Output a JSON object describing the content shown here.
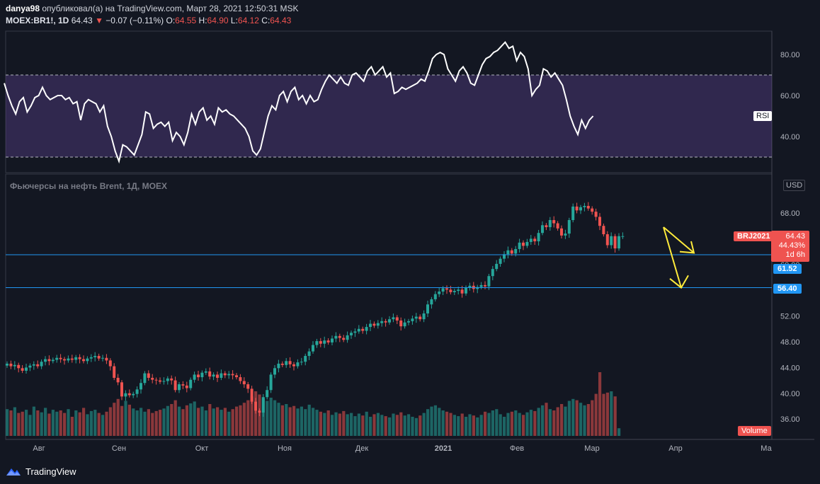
{
  "header": {
    "author": "danya98",
    "published_text": "опубликовал(а) на TradingView.com, Март 28, 2021 12:50:31 MSK",
    "symbol": "MOEX:BR1!, 1D",
    "last": "64.43",
    "change_arrow": "▼",
    "change": "−0.07 (−0.11%)",
    "o_label": "O:",
    "o_value": "64.55",
    "h_label": "H:",
    "h_value": "64.90",
    "l_label": "L:",
    "l_value": "64.12",
    "c_label": "C:",
    "c_value": "64.43"
  },
  "main_title": "Фьючерсы на нефть Brent, 1Д, MOEX",
  "currency_label": "USD",
  "rsi_label": "RSI",
  "volume_label": "Volume",
  "price_tag": {
    "symbol": "BRJ2021",
    "price": "64.43",
    "pct": "44.43%",
    "time": "1d 6h"
  },
  "level_tags": [
    "61.52",
    "56.40"
  ],
  "footer_brand": "TradingView",
  "colors": {
    "up": "#26a69a",
    "down": "#ef5350",
    "rsi_line": "#ffffff",
    "rsi_band": "#7e57c2",
    "hline": "#2196f3",
    "arrow": "#ffeb3b",
    "bg": "#131722"
  },
  "chart_data": [
    {
      "type": "line",
      "title": "RSI",
      "ylim": [
        25,
        95
      ],
      "y_ticks": [
        "80.00",
        "60.00",
        "40.00"
      ],
      "band": [
        30,
        70
      ],
      "values": [
        66,
        60,
        55,
        51,
        57,
        59,
        52,
        55,
        59,
        60,
        64,
        60,
        58,
        59,
        60,
        60,
        58,
        59,
        56,
        57,
        48,
        56,
        58,
        57,
        56,
        52,
        55,
        45,
        40,
        33,
        28,
        36,
        35,
        33,
        31,
        36,
        41,
        52,
        51,
        44,
        46,
        47,
        45,
        47,
        38,
        42,
        40,
        36,
        42,
        51,
        46,
        52,
        54,
        48,
        50,
        46,
        54,
        52,
        53,
        51,
        50,
        48,
        46,
        44,
        40,
        33,
        31,
        34,
        42,
        50,
        55,
        53,
        60,
        62,
        57,
        62,
        64,
        58,
        60,
        56,
        60,
        57,
        58,
        63,
        67,
        70,
        68,
        66,
        69,
        66,
        65,
        70,
        71,
        69,
        67,
        72,
        74,
        70,
        72,
        74,
        69,
        71,
        61,
        62,
        64,
        63,
        64,
        65,
        66,
        68,
        67,
        72,
        78,
        80,
        81,
        80,
        73,
        70,
        67,
        72,
        74,
        71,
        66,
        65,
        70,
        75,
        78,
        79,
        81,
        82,
        84,
        86,
        83,
        84,
        77,
        81,
        79,
        73,
        60,
        63,
        65,
        73,
        72,
        69,
        71,
        68,
        65,
        58,
        50,
        45,
        41,
        48,
        44,
        48,
        50
      ]
    },
    {
      "type": "candlestick",
      "title": "Фьючерсы на нефть Brent, 1Д, MOEX",
      "ylim": [
        33,
        75.5
      ],
      "y_ticks": [
        "68.00",
        "64.00",
        "60.00",
        "56.00",
        "52.00",
        "48.00",
        "44.00",
        "40.00",
        "36.00"
      ],
      "x_ticks": [
        "Авг",
        "Сен",
        "Окт",
        "Ноя",
        "Дек",
        "2021",
        "Фев",
        "Мар",
        "Апр",
        "Ма"
      ],
      "close": [
        44.6,
        44.2,
        44.4,
        43.9,
        43.5,
        44.0,
        44.3,
        44.5,
        44.2,
        44.9,
        45.3,
        45.0,
        45.2,
        45.5,
        45.3,
        45.1,
        45.4,
        45.2,
        45.6,
        45.3,
        45.0,
        45.4,
        45.6,
        45.8,
        45.4,
        45.5,
        45.1,
        44.2,
        42.4,
        41.7,
        39.5,
        40.0,
        39.7,
        39.9,
        40.6,
        41.6,
        43.1,
        42.4,
        42.1,
        42.0,
        41.8,
        41.9,
        42.3,
        42.0,
        40.5,
        41.4,
        41.2,
        40.8,
        42.1,
        42.9,
        42.5,
        43.2,
        43.4,
        42.6,
        42.9,
        42.4,
        43.1,
        42.8,
        43.0,
        42.8,
        42.5,
        41.9,
        41.4,
        40.7,
        38.7,
        37.3,
        37.0,
        39.4,
        40.5,
        42.9,
        43.9,
        44.6,
        44.4,
        45.0,
        44.5,
        44.2,
        44.8,
        44.9,
        45.8,
        46.5,
        47.5,
        48.1,
        47.7,
        48.2,
        47.9,
        48.5,
        48.9,
        48.6,
        48.3,
        49.0,
        49.4,
        49.6,
        50.0,
        49.7,
        50.3,
        50.8,
        50.5,
        50.9,
        51.2,
        51.0,
        51.5,
        51.8,
        51.3,
        50.4,
        51.0,
        51.2,
        51.6,
        51.9,
        51.5,
        52.4,
        53.8,
        54.6,
        55.4,
        55.8,
        56.3,
        56.1,
        55.7,
        55.9,
        56.1,
        55.5,
        56.4,
        56.7,
        56.2,
        56.5,
        56.8,
        56.6,
        58.2,
        59.3,
        60.1,
        60.9,
        61.6,
        62.2,
        61.7,
        62.4,
        63.4,
        62.9,
        63.5,
        64.0,
        63.6,
        64.9,
        66.1,
        65.8,
        66.9,
        66.4,
        65.6,
        64.5,
        64.8,
        66.9,
        69.0,
        68.4,
        68.9,
        69.1,
        68.7,
        68.2,
        67.4,
        66.0,
        64.7,
        63.0,
        64.4,
        62.5,
        64.4,
        64.4
      ],
      "volume": [
        0.42,
        0.4,
        0.45,
        0.36,
        0.38,
        0.41,
        0.33,
        0.46,
        0.4,
        0.37,
        0.44,
        0.35,
        0.41,
        0.38,
        0.4,
        0.36,
        0.42,
        0.3,
        0.4,
        0.37,
        0.44,
        0.34,
        0.39,
        0.41,
        0.36,
        0.33,
        0.38,
        0.45,
        0.52,
        0.58,
        0.47,
        0.55,
        0.49,
        0.43,
        0.4,
        0.44,
        0.38,
        0.42,
        0.36,
        0.39,
        0.41,
        0.43,
        0.47,
        0.5,
        0.56,
        0.46,
        0.42,
        0.48,
        0.51,
        0.54,
        0.44,
        0.46,
        0.4,
        0.5,
        0.43,
        0.45,
        0.41,
        0.44,
        0.38,
        0.42,
        0.46,
        0.48,
        0.52,
        0.56,
        0.62,
        0.7,
        0.65,
        0.58,
        0.55,
        0.6,
        0.56,
        0.52,
        0.48,
        0.5,
        0.45,
        0.47,
        0.43,
        0.46,
        0.42,
        0.49,
        0.44,
        0.41,
        0.38,
        0.36,
        0.4,
        0.33,
        0.37,
        0.35,
        0.39,
        0.34,
        0.36,
        0.31,
        0.35,
        0.32,
        0.38,
        0.3,
        0.34,
        0.36,
        0.33,
        0.31,
        0.29,
        0.35,
        0.33,
        0.37,
        0.32,
        0.34,
        0.3,
        0.28,
        0.32,
        0.36,
        0.42,
        0.46,
        0.48,
        0.44,
        0.4,
        0.38,
        0.36,
        0.33,
        0.31,
        0.35,
        0.3,
        0.34,
        0.32,
        0.29,
        0.33,
        0.38,
        0.36,
        0.4,
        0.42,
        0.34,
        0.3,
        0.36,
        0.38,
        0.4,
        0.36,
        0.33,
        0.37,
        0.41,
        0.39,
        0.44,
        0.48,
        0.52,
        0.42,
        0.4,
        0.45,
        0.5,
        0.46,
        0.55,
        0.58,
        0.56,
        0.52,
        0.48,
        0.5,
        0.56,
        0.66,
        1.0,
        0.66,
        0.68,
        0.7,
        0.62,
        0.12
      ]
    }
  ]
}
